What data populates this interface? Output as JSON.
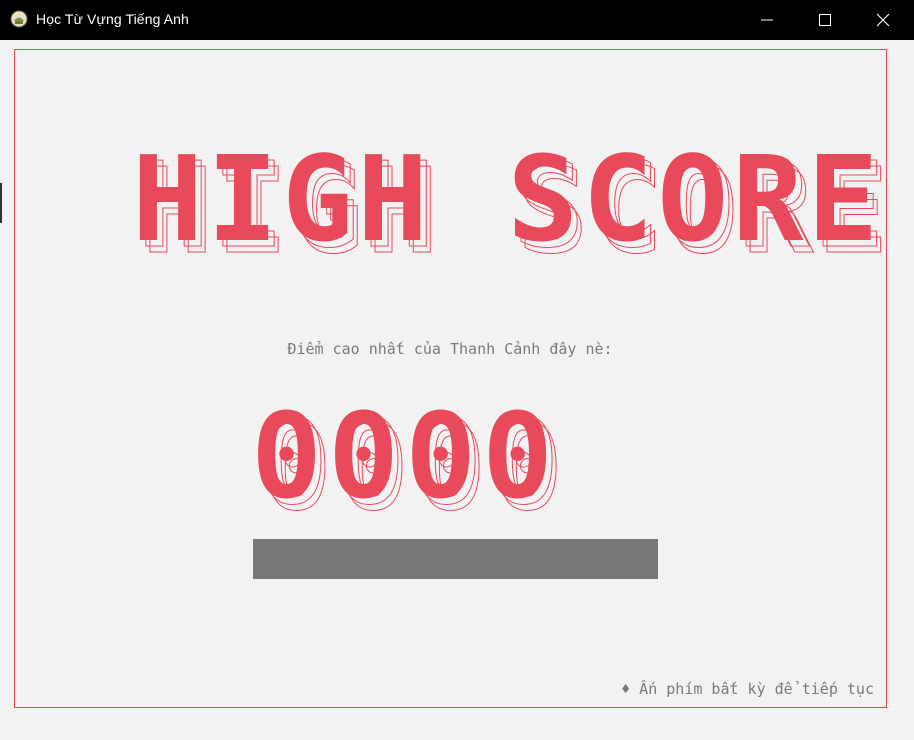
{
  "window": {
    "title": "Học Từ Vựng Tiếng Anh",
    "icon": "app-icon",
    "controls": [
      "minimize-icon",
      "maximize-icon",
      "close-icon"
    ]
  },
  "screen": {
    "heading": "HIGH SCORE",
    "subtitle": "Điểm cao nhất của Thanh Cảnh đây nè:",
    "score": "0000",
    "footer_hint": "♦ Ấn phím bất kỳ để tiếp tục"
  },
  "colors": {
    "accent": "#e84a5b",
    "background": "#f3f2f3",
    "bar": "#777777",
    "muted_text": "#7a7a7a"
  }
}
